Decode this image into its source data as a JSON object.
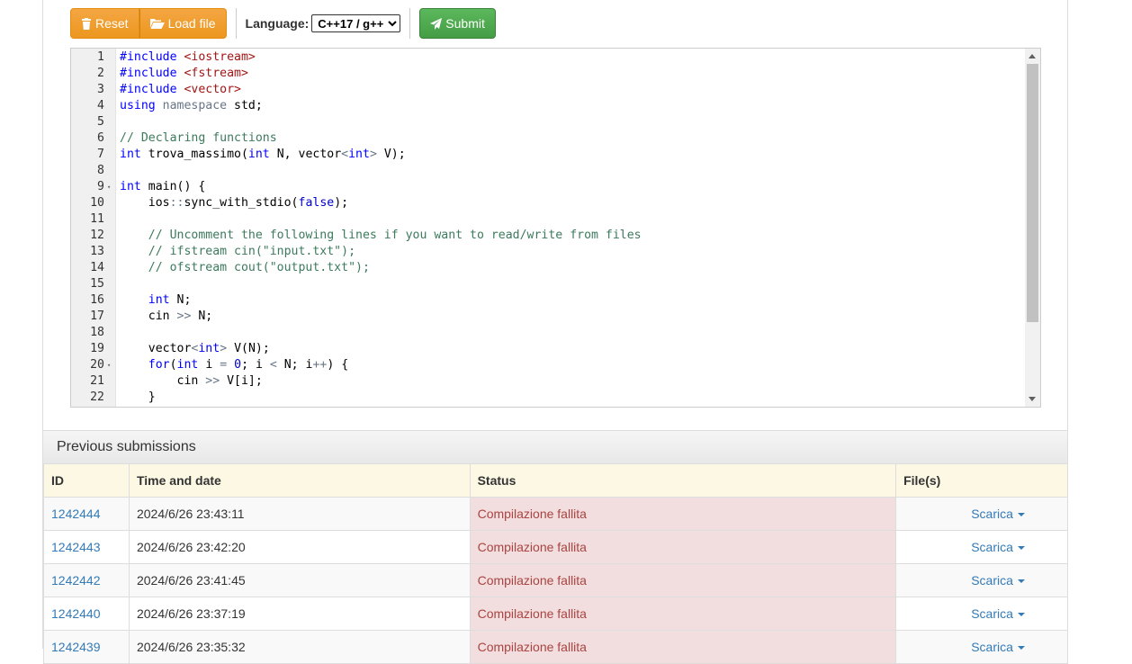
{
  "toolbar": {
    "reset_label": "Reset",
    "load_label": "Load file",
    "language_label": "Language:",
    "language_value": "C++17 / g++",
    "submit_label": "Submit"
  },
  "editor": {
    "lines": [
      {
        "n": "1",
        "fold": false,
        "tokens": [
          {
            "t": "#include ",
            "c": "kw"
          },
          {
            "t": "<iostream>",
            "c": "str"
          }
        ]
      },
      {
        "n": "2",
        "fold": false,
        "tokens": [
          {
            "t": "#include ",
            "c": "kw"
          },
          {
            "t": "<fstream>",
            "c": "str"
          }
        ]
      },
      {
        "n": "3",
        "fold": false,
        "tokens": [
          {
            "t": "#include ",
            "c": "kw"
          },
          {
            "t": "<vector>",
            "c": "str"
          }
        ]
      },
      {
        "n": "4",
        "fold": false,
        "tokens": [
          {
            "t": "using ",
            "c": "kw"
          },
          {
            "t": "namespace ",
            "c": "op"
          },
          {
            "t": "std;",
            "c": ""
          }
        ]
      },
      {
        "n": "5",
        "fold": false,
        "tokens": []
      },
      {
        "n": "6",
        "fold": false,
        "tokens": [
          {
            "t": "// Declaring functions",
            "c": "cm"
          }
        ]
      },
      {
        "n": "7",
        "fold": false,
        "tokens": [
          {
            "t": "int",
            "c": "ty"
          },
          {
            "t": " trova_massimo(",
            "c": ""
          },
          {
            "t": "int",
            "c": "ty"
          },
          {
            "t": " N, vector",
            "c": ""
          },
          {
            "t": "<",
            "c": "op"
          },
          {
            "t": "int",
            "c": "ty"
          },
          {
            "t": ">",
            "c": "op"
          },
          {
            "t": " V);",
            "c": ""
          }
        ]
      },
      {
        "n": "8",
        "fold": false,
        "tokens": []
      },
      {
        "n": "9",
        "fold": true,
        "tokens": [
          {
            "t": "int",
            "c": "ty"
          },
          {
            "t": " main() {",
            "c": ""
          }
        ]
      },
      {
        "n": "10",
        "fold": false,
        "tokens": [
          {
            "t": "    ios",
            "c": ""
          },
          {
            "t": "::",
            "c": "op"
          },
          {
            "t": "sync_with_stdio(",
            "c": ""
          },
          {
            "t": "false",
            "c": "nb"
          },
          {
            "t": ");",
            "c": ""
          }
        ]
      },
      {
        "n": "11",
        "fold": false,
        "tokens": []
      },
      {
        "n": "12",
        "fold": false,
        "tokens": [
          {
            "t": "    // Uncomment the following lines if you want to read/write from files",
            "c": "cm"
          }
        ]
      },
      {
        "n": "13",
        "fold": false,
        "tokens": [
          {
            "t": "    // ifstream cin(\"input.txt\");",
            "c": "cm"
          }
        ]
      },
      {
        "n": "14",
        "fold": false,
        "tokens": [
          {
            "t": "    // ofstream cout(\"output.txt\");",
            "c": "cm"
          }
        ]
      },
      {
        "n": "15",
        "fold": false,
        "tokens": []
      },
      {
        "n": "16",
        "fold": false,
        "tokens": [
          {
            "t": "    ",
            "c": ""
          },
          {
            "t": "int",
            "c": "ty"
          },
          {
            "t": " N;",
            "c": ""
          }
        ]
      },
      {
        "n": "17",
        "fold": false,
        "tokens": [
          {
            "t": "    cin ",
            "c": ""
          },
          {
            "t": ">>",
            "c": "op"
          },
          {
            "t": " N;",
            "c": ""
          }
        ]
      },
      {
        "n": "18",
        "fold": false,
        "tokens": []
      },
      {
        "n": "19",
        "fold": false,
        "tokens": [
          {
            "t": "    vector",
            "c": ""
          },
          {
            "t": "<",
            "c": "op"
          },
          {
            "t": "int",
            "c": "ty"
          },
          {
            "t": ">",
            "c": "op"
          },
          {
            "t": " V(N);",
            "c": ""
          }
        ]
      },
      {
        "n": "20",
        "fold": true,
        "tokens": [
          {
            "t": "    ",
            "c": ""
          },
          {
            "t": "for",
            "c": "kw"
          },
          {
            "t": "(",
            "c": ""
          },
          {
            "t": "int",
            "c": "ty"
          },
          {
            "t": " i ",
            "c": ""
          },
          {
            "t": "=",
            "c": "op"
          },
          {
            "t": " ",
            "c": ""
          },
          {
            "t": "0",
            "c": "nb"
          },
          {
            "t": "; i ",
            "c": ""
          },
          {
            "t": "<",
            "c": "op"
          },
          {
            "t": " N; i",
            "c": ""
          },
          {
            "t": "++",
            "c": "op"
          },
          {
            "t": ") {",
            "c": ""
          }
        ]
      },
      {
        "n": "21",
        "fold": false,
        "tokens": [
          {
            "t": "        cin ",
            "c": ""
          },
          {
            "t": ">>",
            "c": "op"
          },
          {
            "t": " V[i];",
            "c": ""
          }
        ]
      },
      {
        "n": "22",
        "fold": false,
        "tokens": [
          {
            "t": "    }",
            "c": ""
          }
        ]
      }
    ]
  },
  "submissions": {
    "heading": "Previous submissions",
    "columns": [
      "ID",
      "Time and date",
      "Status",
      "File(s)"
    ],
    "download_label": "Scarica",
    "rows": [
      {
        "id": "1242444",
        "time": "2024/6/26 23:43:11",
        "status": "Compilazione fallita"
      },
      {
        "id": "1242443",
        "time": "2024/6/26 23:42:20",
        "status": "Compilazione fallita"
      },
      {
        "id": "1242442",
        "time": "2024/6/26 23:41:45",
        "status": "Compilazione fallita"
      },
      {
        "id": "1242440",
        "time": "2024/6/26 23:37:19",
        "status": "Compilazione fallita"
      },
      {
        "id": "1242439",
        "time": "2024/6/26 23:35:32",
        "status": "Compilazione fallita"
      }
    ]
  }
}
